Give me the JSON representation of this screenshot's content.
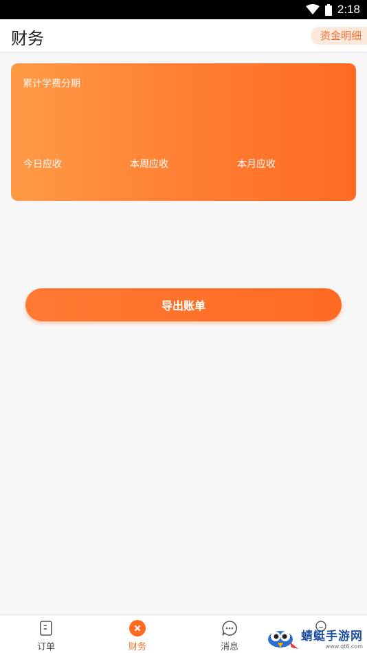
{
  "status_bar": {
    "time": "2:18"
  },
  "header": {
    "title": "财务",
    "detail_button": "资金明细"
  },
  "card": {
    "title": "累计学费分期",
    "stats": [
      "今日应收",
      "本周应收",
      "本月应收"
    ]
  },
  "export_button": "导出账单",
  "bottom_nav": {
    "items": [
      {
        "label": "订单",
        "icon": "document-icon"
      },
      {
        "label": "财务",
        "icon": "finance-icon"
      },
      {
        "label": "消息",
        "icon": "message-icon"
      },
      {
        "label": "",
        "icon": "profile-icon"
      }
    ],
    "active_index": 1
  },
  "colors": {
    "accent": "#ff6a22",
    "accent_light": "#ff9a45"
  },
  "watermark": {
    "main": "蜻蜓手游网",
    "sub": "www.qt6.com"
  }
}
